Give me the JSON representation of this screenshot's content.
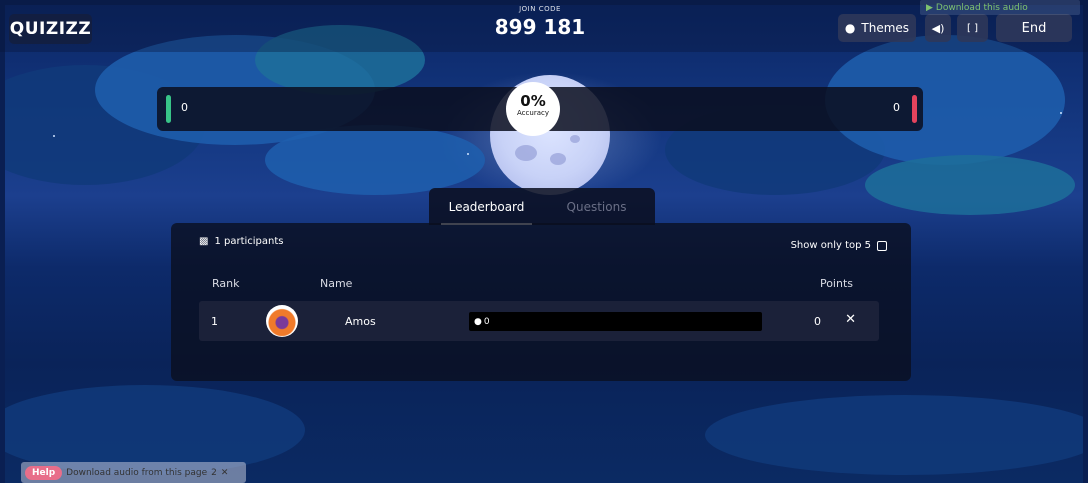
{
  "topbar": {
    "logo": "QUIZIZZ",
    "join_label": "JOIN CODE",
    "join_code": "899 181",
    "themes_label": "Themes",
    "end_label": "End",
    "download_audio": "Download this audio"
  },
  "accuracy": {
    "correct_count": "0",
    "incorrect_count": "0",
    "percent": "0%",
    "label": "Accuracy"
  },
  "tabs": [
    {
      "label": "Leaderboard",
      "active": true
    },
    {
      "label": "Questions",
      "active": false
    }
  ],
  "leaderboard": {
    "participants": "1 participants",
    "show_top_label": "Show only top 5",
    "columns": {
      "rank": "Rank",
      "name": "Name",
      "points": "Points"
    },
    "rows": [
      {
        "rank": "1",
        "name": "Amos",
        "streak": "0",
        "points": "0"
      }
    ]
  },
  "extension_bar": {
    "help": "Help",
    "text": "Download audio from this page",
    "count": "2"
  },
  "colors": {
    "correct": "#38c488",
    "incorrect": "#e3435d",
    "background": "#1c3f8e"
  },
  "icons": [
    "palette-icon",
    "speaker-icon",
    "fullscreen-icon",
    "participants-icon",
    "water-drop-icon",
    "close-icon"
  ]
}
